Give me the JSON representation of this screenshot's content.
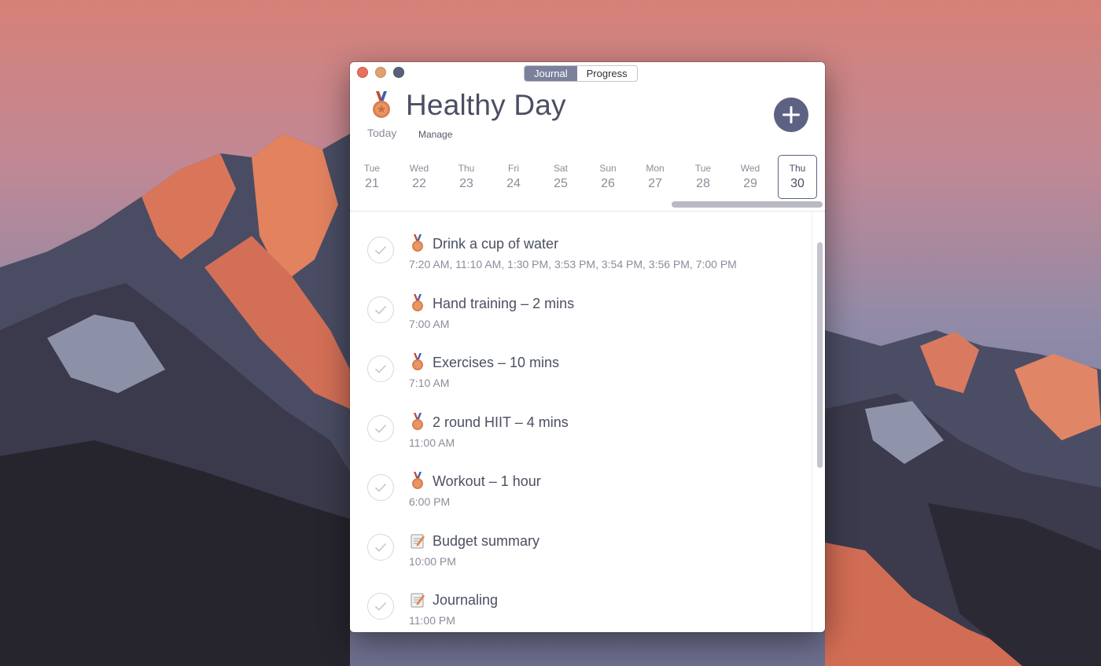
{
  "window": {
    "tabs": [
      {
        "label": "Journal",
        "active": true
      },
      {
        "label": "Progress",
        "active": false
      }
    ]
  },
  "header": {
    "title": "Healthy Day",
    "today_label": "Today",
    "manage_label": "Manage",
    "add_icon": "plus-icon"
  },
  "days": [
    {
      "dow": "Tue",
      "num": "21"
    },
    {
      "dow": "Wed",
      "num": "22"
    },
    {
      "dow": "Thu",
      "num": "23"
    },
    {
      "dow": "Fri",
      "num": "24"
    },
    {
      "dow": "Sat",
      "num": "25"
    },
    {
      "dow": "Sun",
      "num": "26"
    },
    {
      "dow": "Mon",
      "num": "27"
    },
    {
      "dow": "Tue",
      "num": "28"
    },
    {
      "dow": "Wed",
      "num": "29"
    },
    {
      "dow": "Thu",
      "num": "30",
      "selected": true
    }
  ],
  "tasks": [
    {
      "icon": "medal-icon",
      "title": "Drink a cup of water",
      "times": "7:20 AM, 11:10 AM, 1:30 PM, 3:53 PM, 3:54 PM, 3:56 PM, 7:00 PM"
    },
    {
      "icon": "medal-icon",
      "title": "Hand training – 2 mins",
      "times": "7:00 AM"
    },
    {
      "icon": "medal-icon",
      "title": "Exercises – 10 mins",
      "times": "7:10 AM"
    },
    {
      "icon": "medal-icon",
      "title": "2 round HIIT – 4 mins",
      "times": "11:00 AM"
    },
    {
      "icon": "medal-icon",
      "title": "Workout – 1 hour",
      "times": "6:00 PM"
    },
    {
      "icon": "memo-icon",
      "title": "Budget summary",
      "times": "10:00 PM"
    },
    {
      "icon": "memo-icon",
      "title": "Journaling",
      "times": "11:00 PM"
    }
  ],
  "colors": {
    "accent": "#5d6283",
    "title_text": "#4b4f63",
    "secondary_text": "#8a8d99"
  }
}
